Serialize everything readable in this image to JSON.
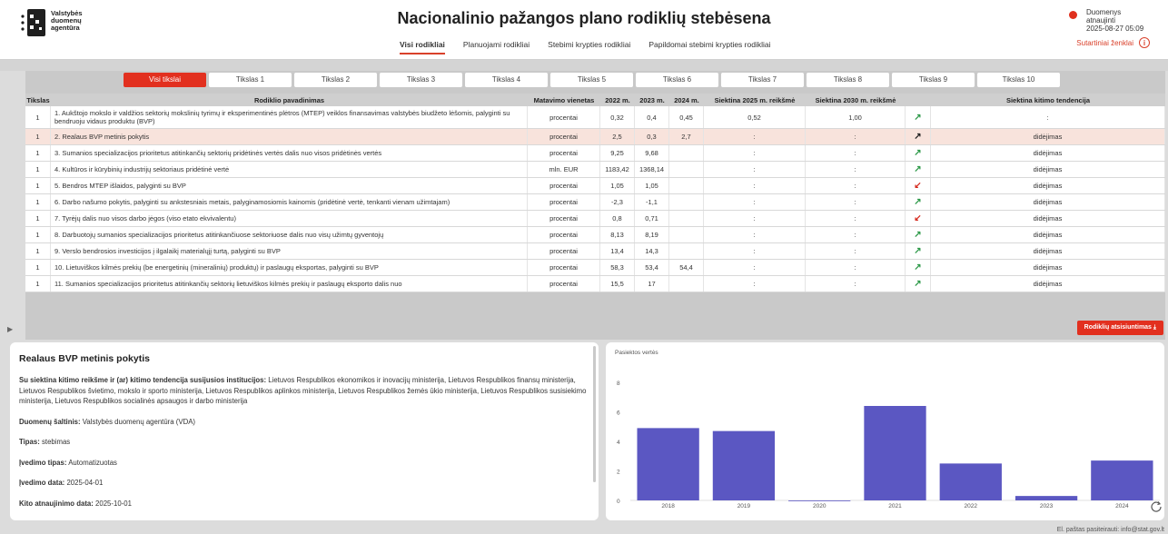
{
  "header": {
    "logo_lines": [
      "Valstybės",
      "duomenų",
      "agentūra"
    ],
    "title": "Nacionalinio pažangos plano rodiklių stebėsena",
    "nav": [
      "Visi rodikliai",
      "Planuojami rodikliai",
      "Stebimi krypties rodikliai",
      "Papildomai stebimi krypties rodikliai"
    ],
    "status_line1": "Duomenys atnaujinti",
    "status_line2": "2025-08-27 05:09",
    "legend_link": "Sutartiniai ženklai",
    "info_icon_glyph": "i"
  },
  "tabs": [
    "Visi tikslai",
    "Tikslas 1",
    "Tikslas 2",
    "Tikslas 3",
    "Tikslas 4",
    "Tikslas 5",
    "Tikslas 6",
    "Tikslas 7",
    "Tikslas 8",
    "Tikslas 9",
    "Tikslas 10"
  ],
  "table": {
    "headers": [
      "Tikslas",
      "Rodiklio pavadinimas",
      "Matavimo vienetas",
      "2022 m.",
      "2023 m.",
      "2024 m.",
      "Siektina 2025 m. reikšmė",
      "Siektina 2030 m. reikšmė",
      "",
      "Siektina kitimo tendencija"
    ],
    "rows": [
      {
        "goal": "1",
        "name": "1. Aukštojo mokslo ir valdžios sektorių mokslinių tyrimų ir eksperimentinės plėtros (MTEP) veiklos finansavimas valstybės biudžeto lėšomis, palyginti su bendruoju vidaus produktu (BVP)",
        "unit": "procentai",
        "y2022": "0,32",
        "y2023": "0,4",
        "y2024": "0,45",
        "t2025": "0,52",
        "t2030": "1,00",
        "arrow": "↗",
        "trend": ":"
      },
      {
        "goal": "1",
        "name": "2. Realaus BVP metinis pokytis",
        "unit": "procentai",
        "y2022": "2,5",
        "y2023": "0,3",
        "y2024": "2,7",
        "t2025": ":",
        "t2030": ":",
        "arrow": "↗",
        "trend": "didėjimas"
      },
      {
        "goal": "1",
        "name": "3. Sumanios specializacijos prioritetus atitinkančių sektorių pridėtinės vertės dalis nuo visos pridėtinės vertės",
        "unit": "procentai",
        "y2022": "9,25",
        "y2023": "9,68",
        "y2024": "",
        "t2025": ":",
        "t2030": ":",
        "arrow": "↗",
        "trend": "didėjimas"
      },
      {
        "goal": "1",
        "name": "4. Kultūros ir kūrybinių industrijų sektoriaus pridėtinė vertė",
        "unit": "mln. EUR",
        "y2022": "1183,42",
        "y2023": "1368,14",
        "y2024": "",
        "t2025": ":",
        "t2030": ":",
        "arrow": "↗",
        "trend": "didėjimas"
      },
      {
        "goal": "1",
        "name": "5. Bendros MTEP išlaidos, palyginti su BVP",
        "unit": "procentai",
        "y2022": "1,05",
        "y2023": "1,05",
        "y2024": "",
        "t2025": ":",
        "t2030": ":",
        "arrow": "↙",
        "trend": "didėjimas"
      },
      {
        "goal": "1",
        "name": "6. Darbo našumo pokytis, palyginti su ankstesniais metais, palyginamosiomis kainomis (pridėtinė vertė, tenkanti vienam užimtajam)",
        "unit": "procentai",
        "y2022": "-2,3",
        "y2023": "-1,1",
        "y2024": "",
        "t2025": ":",
        "t2030": ":",
        "arrow": "↗",
        "trend": "didėjimas"
      },
      {
        "goal": "1",
        "name": "7. Tyrėjų dalis nuo visos darbo jėgos (viso etato ekvivalentu)",
        "unit": "procentai",
        "y2022": "0,8",
        "y2023": "0,71",
        "y2024": "",
        "t2025": ":",
        "t2030": ":",
        "arrow": "↙",
        "trend": "didėjimas"
      },
      {
        "goal": "1",
        "name": "8. Darbuotojų sumanios specializacijos prioritetus atitinkančiuose sektoriuose dalis nuo visų užimtų gyventojų",
        "unit": "procentai",
        "y2022": "8,13",
        "y2023": "8,19",
        "y2024": "",
        "t2025": ":",
        "t2030": ":",
        "arrow": "↗",
        "trend": "didėjimas"
      },
      {
        "goal": "1",
        "name": "9. Verslo bendrosios investicijos į ilgalaikį materialųjį turtą, palyginti su BVP",
        "unit": "procentai",
        "y2022": "13,4",
        "y2023": "14,3",
        "y2024": "",
        "t2025": ":",
        "t2030": ":",
        "arrow": "↗",
        "trend": "didėjimas"
      },
      {
        "goal": "1",
        "name": "10. Lietuviškos kilmės prekių (be energetinių (mineralinių) produktų) ir paslaugų eksportas, palyginti su BVP",
        "unit": "procentai",
        "y2022": "58,3",
        "y2023": "53,4",
        "y2024": "54,4",
        "t2025": ":",
        "t2030": ":",
        "arrow": "↗",
        "trend": "didėjimas"
      },
      {
        "goal": "1",
        "name": "11. Sumanios specializacijos prioritetus atitinkančių sektorių lietuviškos kilmės prekių ir paslaugų eksporto dalis nuo",
        "unit": "procentai",
        "y2022": "15,5",
        "y2023": "17",
        "y2024": "",
        "t2025": ":",
        "t2030": ":",
        "arrow": "↗",
        "trend": "didėjimas"
      }
    ],
    "download_label": "Rodiklių atsisiuntimas ⤓"
  },
  "info": {
    "title": "Realaus BVP metinis pokytis",
    "inst_label": "Su siektina kitimo reikšme ir (ar) kitimo tendencija susijusios institucijos:",
    "inst_value": "Lietuvos Respublikos ekonomikos ir inovacijų ministerija, Lietuvos Respublikos finansų ministerija, Lietuvos Respublikos švietimo, mokslo ir sporto ministerija, Lietuvos Respublikos aplinkos ministerija, Lietuvos Respublikos žemės ūkio ministerija, Lietuvos Respublikos susisiekimo ministerija, Lietuvos Respublikos socialinės apsaugos ir darbo ministerija",
    "source_label": "Duomenų šaltinis:",
    "source_value": "Valstybės duomenų agentūra (VDA)",
    "type_label": "Tipas:",
    "type_value": "stebimas",
    "entry_label": "Įvedimo tipas:",
    "entry_value": "Automatizuotas",
    "date_label": "Įvedimo data:",
    "date_value": "2025-04-01",
    "next_label": "Kito atnaujinimo data:",
    "next_value": "2025-10-01"
  },
  "chart_data": {
    "type": "bar",
    "title": "Pasiektos vertės",
    "categories": [
      "2018",
      "2019",
      "2020",
      "2021",
      "2022",
      "2023",
      "2024"
    ],
    "values": [
      4.9,
      4.7,
      -0.05,
      6.4,
      2.5,
      0.3,
      2.7
    ],
    "yticks": [
      "0",
      "2",
      "4",
      "6",
      "8"
    ],
    "ylim": [
      0,
      8
    ],
    "color": "#5b57c2"
  },
  "footer": "El. paštas pasiteirauti: info@stat.gov.lt"
}
